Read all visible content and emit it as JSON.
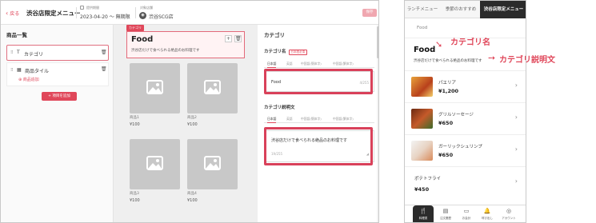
{
  "editor": {
    "back_label": "戻る",
    "menu_title": "渋谷店限定メニュー",
    "period_label": "提供期間",
    "period_value": "2023-04-20 ～ 無期限",
    "store_label": "対象店舗",
    "store_value": "渋谷SCG店",
    "save_label": "保存"
  },
  "product_list": {
    "title": "商品一覧",
    "category_item": "カテゴリ",
    "tile_item": "商品タイル",
    "add_product": "商品追加",
    "add_category_button": "+ 項目を追加"
  },
  "preview": {
    "tag": "カテゴリ",
    "title": "Food",
    "description": "渋谷店だけで食べられる絶品のお料理です",
    "products": [
      {
        "name": "商品1",
        "price": "¥100"
      },
      {
        "name": "商品2",
        "price": "¥100"
      },
      {
        "name": "商品3",
        "price": "¥100"
      },
      {
        "name": "商品4",
        "price": "¥100"
      }
    ]
  },
  "category_panel": {
    "title": "カテゴリ",
    "name_label": "カテゴリ名",
    "required_badge": "日本語必須",
    "lang_tabs": [
      "日本語",
      "英語",
      "中国語(簡体字)",
      "中国語(繁体字)"
    ],
    "name_value": "Food",
    "name_count": "4/255",
    "desc_label": "カテゴリ説明文",
    "desc_value": "渋谷店だけで食べられる絶品のお料理です",
    "desc_count": "19/255"
  },
  "phone": {
    "tabs": [
      "ランチメニュー",
      "季節のおすすめ",
      "渋谷店限定メニュー"
    ],
    "subtab": "Food",
    "category_title": "Food",
    "category_desc": "渋谷店だけで食べられる絶品のお料理です",
    "items": [
      {
        "name": "パエリア",
        "price": "¥1,200"
      },
      {
        "name": "グリルソーセージ",
        "price": "¥650"
      },
      {
        "name": "ガーリックシュリンプ",
        "price": "¥650"
      },
      {
        "name": "ポテトフライ",
        "price": "¥450"
      }
    ],
    "nav": [
      "料理書",
      "注文履歴",
      "お会計",
      "呼び出し",
      "アカウント"
    ]
  },
  "annotations": {
    "name": "カテゴリ名",
    "description": "カテゴリ説明文"
  },
  "colors": {
    "accent": "#e0475a",
    "highlight": "#d9415a",
    "dark_tab": "#2b2b2b"
  }
}
